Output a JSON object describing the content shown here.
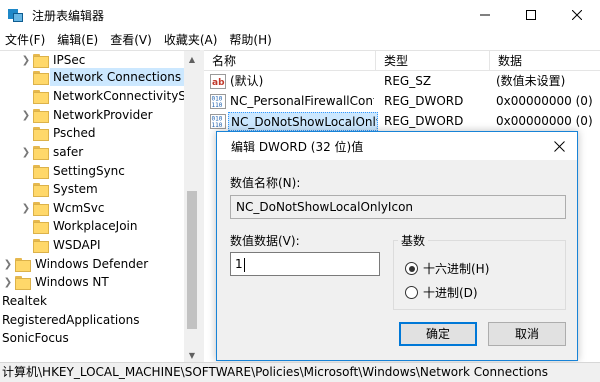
{
  "window": {
    "title": "注册表编辑器",
    "icon": "regedit-icon",
    "controls": [
      "minimize-icon",
      "maximize-icon",
      "close-icon"
    ]
  },
  "menu": [
    {
      "label": "文件(F)"
    },
    {
      "label": "编辑(E)"
    },
    {
      "label": "查看(V)"
    },
    {
      "label": "收藏夹(A)"
    },
    {
      "label": "帮助(H)"
    }
  ],
  "tree": {
    "items": [
      {
        "label": "IPSec",
        "expandable": true,
        "selected": false
      },
      {
        "label": "Network Connections",
        "expandable": false,
        "selected": true
      },
      {
        "label": "NetworkConnectivityStat",
        "expandable": false,
        "selected": false
      },
      {
        "label": "NetworkProvider",
        "expandable": true,
        "selected": false
      },
      {
        "label": "Psched",
        "expandable": false,
        "selected": false
      },
      {
        "label": "safer",
        "expandable": true,
        "selected": false
      },
      {
        "label": "SettingSync",
        "expandable": false,
        "selected": false
      },
      {
        "label": "System",
        "expandable": false,
        "selected": false
      },
      {
        "label": "WcmSvc",
        "expandable": true,
        "selected": false
      },
      {
        "label": "WorkplaceJoin",
        "expandable": false,
        "selected": false
      },
      {
        "label": "WSDAPI",
        "expandable": false,
        "selected": false
      },
      {
        "label": "Windows Defender",
        "expandable": true,
        "selected": false
      },
      {
        "label": "Windows NT",
        "expandable": true,
        "selected": false
      },
      {
        "label": "Realtek",
        "expandable": false,
        "selected": false
      },
      {
        "label": "RegisteredApplications",
        "expandable": false,
        "selected": false
      },
      {
        "label": "SonicFocus",
        "expandable": false,
        "selected": false
      }
    ]
  },
  "list": {
    "headers": {
      "name": "名称",
      "type": "类型",
      "data": "数据"
    },
    "rows": [
      {
        "name": "(默认)",
        "type": "REG_SZ",
        "data": "(数值未设置)",
        "icon": "string-value-icon"
      },
      {
        "name": "NC_PersonalFirewallConfig",
        "type": "REG_DWORD",
        "data": "0x00000000 (0)",
        "icon": "binary-value-icon"
      },
      {
        "name": "NC_DoNotShowLocalOnly...",
        "type": "REG_DWORD",
        "data": "0x00000000 (0)",
        "icon": "binary-value-icon"
      }
    ]
  },
  "dialog": {
    "title": "编辑 DWORD (32 位)值",
    "value_name_label": "数值名称(N):",
    "value_name": "NC_DoNotShowLocalOnlyIcon",
    "value_data_label": "数值数据(V):",
    "value_data": "1",
    "base_label": "基数",
    "hex_label": "十六进制(H)",
    "dec_label": "十进制(D)",
    "selected_base": "hex",
    "ok_label": "确定",
    "cancel_label": "取消"
  },
  "status": {
    "path": "计算机\\HKEY_LOCAL_MACHINE\\SOFTWARE\\Policies\\Microsoft\\Windows\\Network Connections"
  },
  "colors": {
    "selection": "#cce8ff",
    "accent": "#0078d7",
    "folder": "#ffd86a"
  }
}
